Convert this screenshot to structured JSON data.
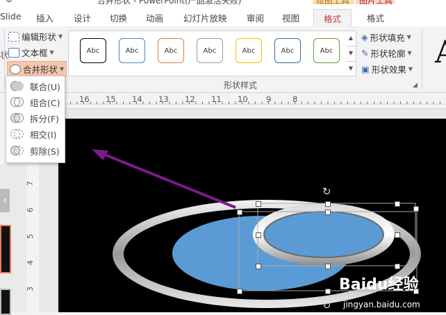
{
  "titlebar": {
    "title": "合并形状 - PowerPoint(产品激活失败)",
    "context_tab_1": "绘图工具",
    "context_tab_2": "图片工具"
  },
  "tabs": [
    {
      "label": "Slide"
    },
    {
      "label": "插入"
    },
    {
      "label": "设计"
    },
    {
      "label": "切换"
    },
    {
      "label": "动画"
    },
    {
      "label": "幻灯片放映"
    },
    {
      "label": "审阅"
    },
    {
      "label": "视图"
    },
    {
      "label": "格式",
      "active": true
    },
    {
      "label": "格式"
    }
  ],
  "ribbon": {
    "edit_shape": "编辑形状",
    "text_box": "文本框",
    "merge_shapes": "合并形状",
    "style_sample": "Abc",
    "shape_fill": "形状填充",
    "shape_outline": "形状轮廓",
    "shape_effects": "形状效果",
    "group_label": "形状样式",
    "left_cut_label": "状",
    "wordart_letter": "A"
  },
  "style_colors": [
    "#000000",
    "#4f81bd",
    "#e07b39",
    "#999999",
    "#e6c300",
    "#2e6da4",
    "#5a9e3a"
  ],
  "menu": {
    "items": [
      {
        "label": "联合(U)"
      },
      {
        "label": "组合(C)"
      },
      {
        "label": "拆分(F)"
      },
      {
        "label": "相交(I)"
      },
      {
        "label": "剪除(S)"
      }
    ]
  },
  "ruler": {
    "h_ticks": [
      "16",
      "15",
      "14",
      "13",
      "12",
      "11",
      "10",
      "9",
      "8"
    ],
    "v_ticks": [
      "7",
      "6",
      "5",
      "4",
      "3"
    ]
  },
  "watermark": {
    "brand": "Baidu经验",
    "url": "jingyan.baidu.com"
  },
  "colors": {
    "accent_tab": "#c0392b",
    "arrow": "#7b1a8c",
    "ellipse_fill": "#5b9bd5",
    "slide_bg": "#000000"
  }
}
